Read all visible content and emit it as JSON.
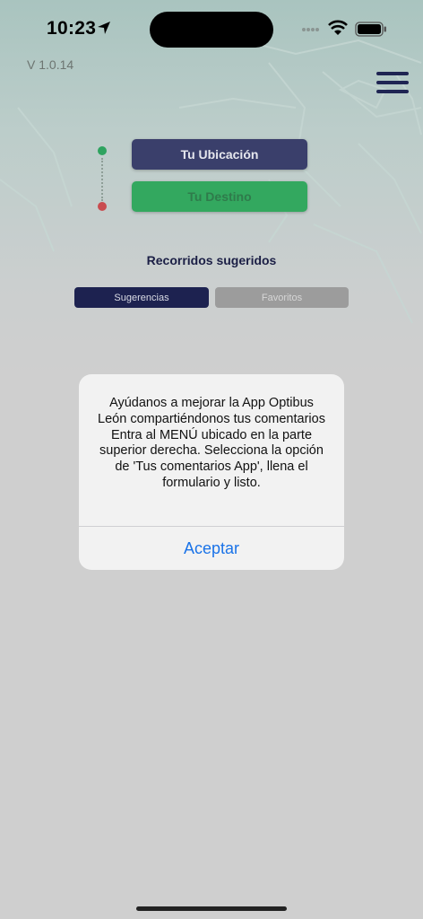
{
  "status_bar": {
    "time": "10:23"
  },
  "app": {
    "version": "V 1.0.14"
  },
  "route": {
    "origin_label": "Tu Ubicación",
    "destination_label": "Tu Destino"
  },
  "suggested": {
    "title": "Recorridos sugeridos",
    "tabs": [
      {
        "label": "Sugerencias"
      },
      {
        "label": "Favoritos"
      }
    ]
  },
  "alert": {
    "message": "Ayúdanos a mejorar la App Optibus León compartiéndonos tus comentarios Entra al MENÚ   ubicado en la parte superior derecha. Selecciona la opción de 'Tus comentarios App', llena el formulario y listo.",
    "button_label": "Aceptar"
  },
  "colors": {
    "navy": "#1d2250",
    "green": "#33a85f",
    "link_blue": "#1a73e8"
  }
}
